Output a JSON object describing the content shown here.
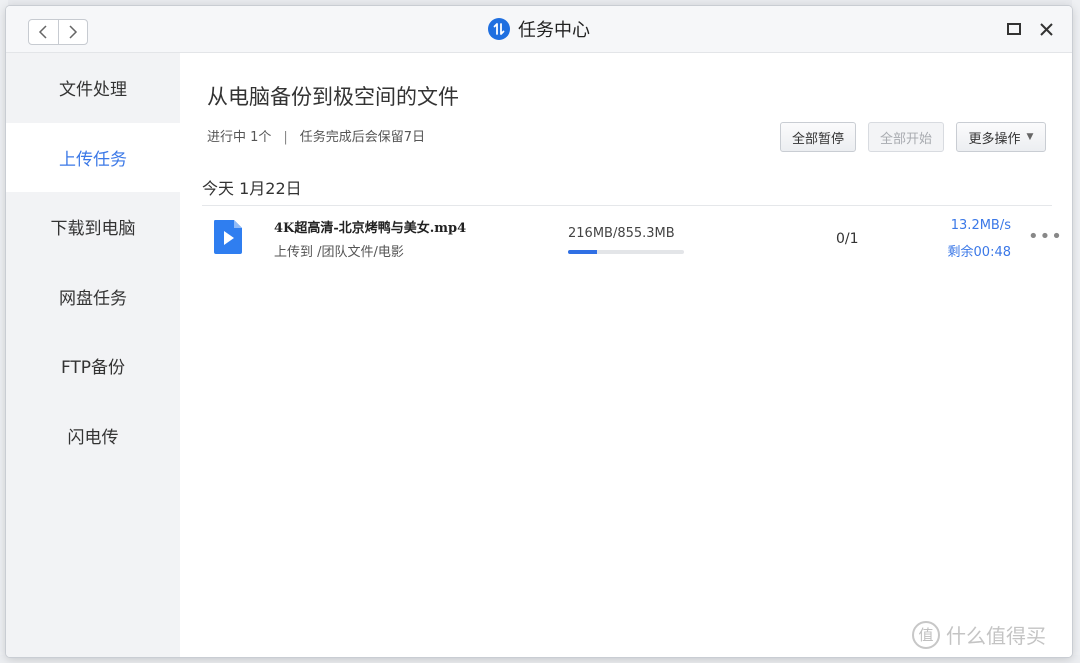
{
  "window": {
    "title": "任务中心",
    "app_icon": "transfer-arrows-icon",
    "accent_color": "#3b78e7"
  },
  "sidebar": {
    "items": [
      {
        "label": "文件处理",
        "active": false
      },
      {
        "label": "上传任务",
        "active": true
      },
      {
        "label": "下载到电脑",
        "active": false
      },
      {
        "label": "网盘任务",
        "active": false
      },
      {
        "label": "FTP备份",
        "active": false
      },
      {
        "label": "闪电传",
        "active": false
      }
    ]
  },
  "main": {
    "title": "从电脑备份到极空间的文件",
    "status_running": "进行中 1个",
    "separator": "|",
    "status_retention": "任务完成后会保留7日",
    "buttons": {
      "pause_all": "全部暂停",
      "start_all": "全部开始",
      "more_actions": "更多操作"
    },
    "date_header": "今天 1月22日",
    "tasks": [
      {
        "file_name": "4K超高清-北京烤鸭与美女.mp4",
        "destination": "上传到 /团队文件/电影",
        "size_progress": "216MB/855.3MB",
        "progress_fraction": 0.2525,
        "count": "0/1",
        "speed": "13.2MB/s",
        "remaining": "剩余00:48",
        "file_icon": "video-file-icon"
      }
    ]
  },
  "watermark": {
    "symbol": "值",
    "text": "什么值得买"
  }
}
